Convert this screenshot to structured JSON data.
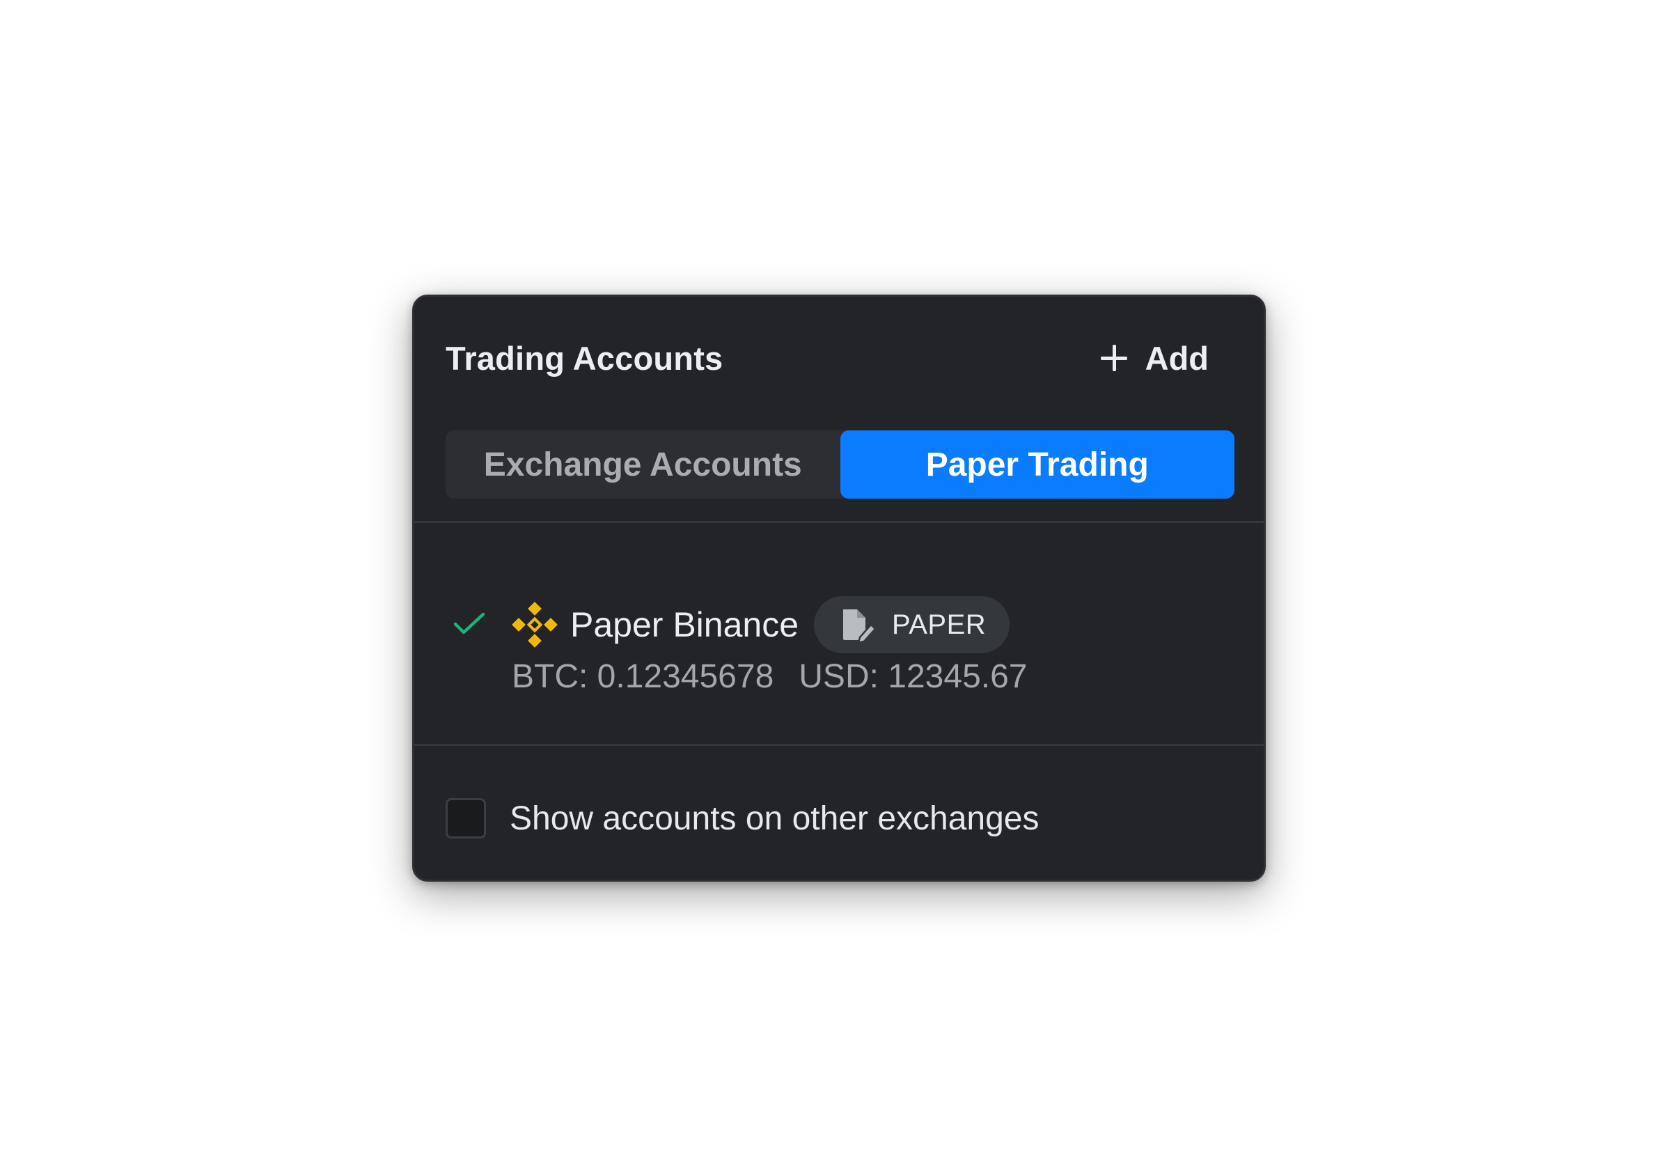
{
  "panel": {
    "title": "Trading Accounts",
    "add_label": "Add"
  },
  "tabs": [
    {
      "label": "Exchange Accounts",
      "active": false
    },
    {
      "label": "Paper Trading",
      "active": true
    }
  ],
  "account": {
    "selected": true,
    "exchange_icon": "binance-icon",
    "name": "Paper Binance",
    "badge": "PAPER",
    "badge_icon": "paper-document-icon",
    "btc": "BTC: 0.12345678",
    "usd": "USD: 12345.67"
  },
  "footer": {
    "checkbox_checked": false,
    "label": "Show accounts on other exchanges"
  },
  "colors": {
    "panel_bg": "#232427",
    "accent": "#0a7cff",
    "check": "#18b47a",
    "binance": "#f0b90b"
  }
}
